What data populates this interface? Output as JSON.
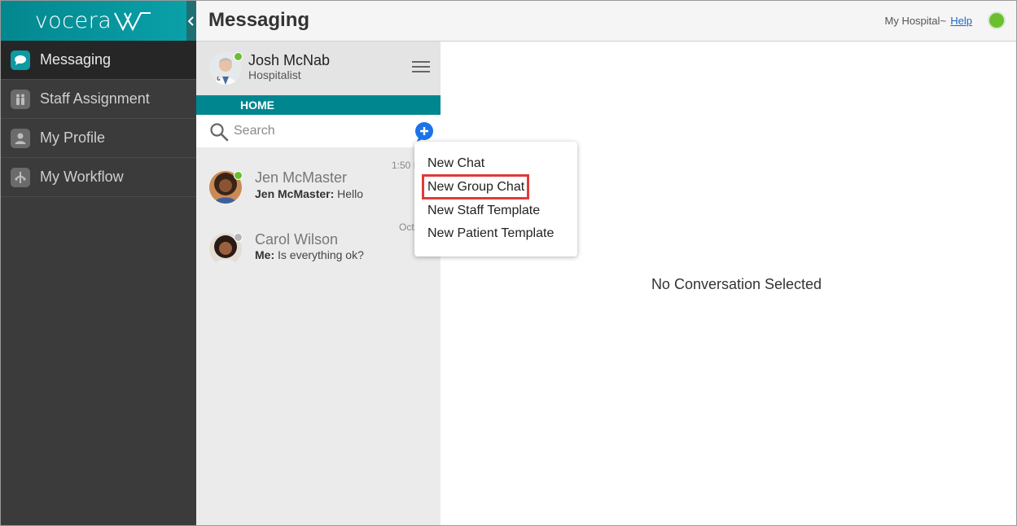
{
  "brand": {
    "logo_text": "vocera"
  },
  "nav": {
    "items": [
      {
        "label": "Messaging",
        "icon": "chat-bubble-icon",
        "active": true
      },
      {
        "label": "Staff Assignment",
        "icon": "staff-icon",
        "active": false
      },
      {
        "label": "My Profile",
        "icon": "person-icon",
        "active": false
      },
      {
        "label": "My Workflow",
        "icon": "workflow-icon",
        "active": false
      }
    ]
  },
  "header": {
    "title": "Messaging",
    "hospital": "My Hospital~",
    "help_label": "Help",
    "status_color": "#6abf2e"
  },
  "profile": {
    "name": "Josh McNab",
    "role": "Hospitalist",
    "presence_color": "#6abf2e"
  },
  "home_label": "HOME",
  "search": {
    "placeholder": "Search",
    "value": ""
  },
  "conversations": [
    {
      "name": "Jen McMaster",
      "sender": "Jen McMaster:",
      "message": "Hello",
      "time": "1:50 P",
      "presence_color": "#6abf2e"
    },
    {
      "name": "Carol Wilson",
      "sender": "Me:",
      "message": "Is everything ok?",
      "time": "Oct",
      "presence_color": "#b5b5b5"
    }
  ],
  "dropdown": {
    "items": [
      "New Chat",
      "New Group Chat",
      "New Staff Template",
      "New Patient Template"
    ],
    "highlighted": "New Group Chat"
  },
  "main": {
    "empty_message": "No Conversation Selected"
  },
  "colors": {
    "accent": "#00868f",
    "nav_bg": "#3b3b3b",
    "highlight": "#e03a3a"
  }
}
